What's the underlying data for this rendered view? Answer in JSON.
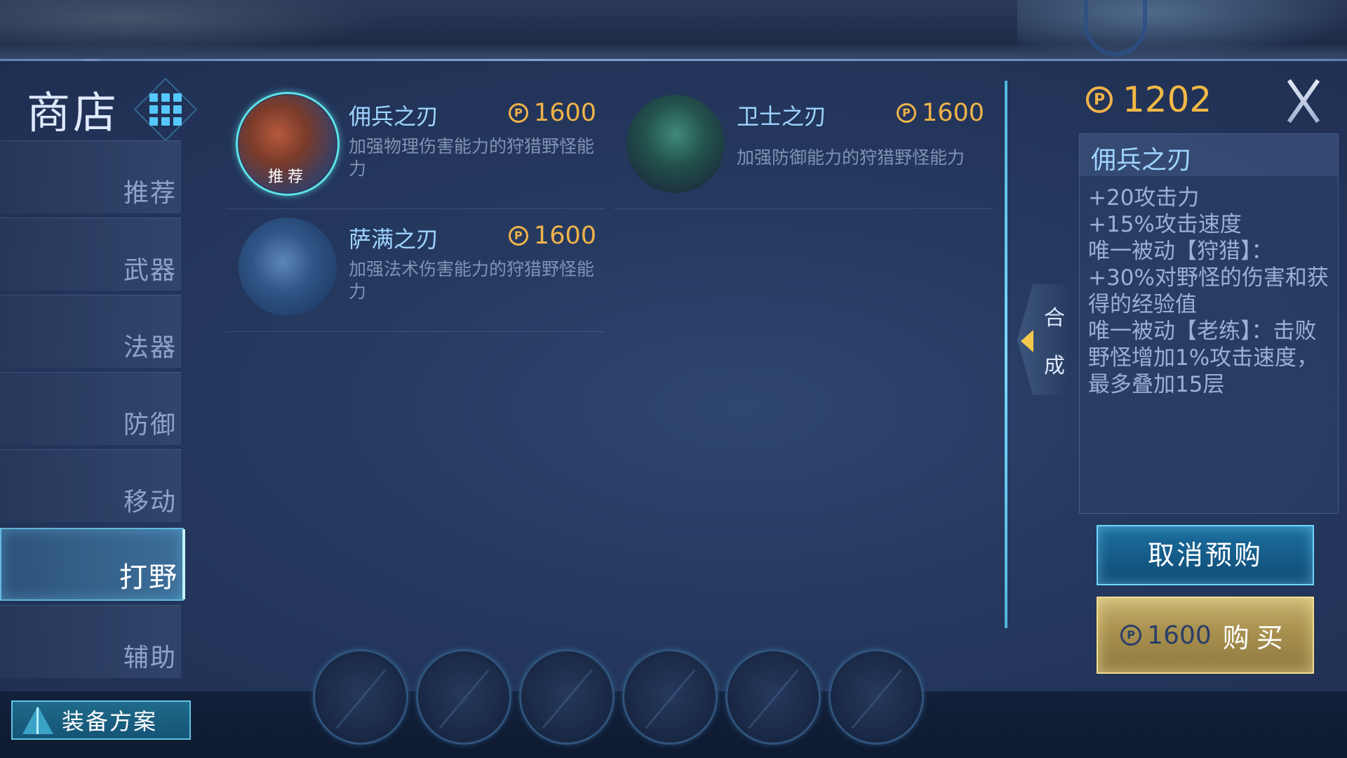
{
  "header": {
    "title": "商店",
    "gold": "1202"
  },
  "categories": [
    {
      "label": "推荐",
      "active": false
    },
    {
      "label": "武器",
      "active": false
    },
    {
      "label": "法器",
      "active": false
    },
    {
      "label": "防御",
      "active": false
    },
    {
      "label": "移动",
      "active": false
    },
    {
      "label": "打野",
      "active": true
    },
    {
      "label": "辅助",
      "active": false
    }
  ],
  "items": [
    {
      "name": "佣兵之刃",
      "price": "1600",
      "desc": "加强物理伤害能力的狩猎野怪能力",
      "badge": "推荐"
    },
    {
      "name": "卫士之刃",
      "price": "1600",
      "desc": "加强防御能力的狩猎野怪能力"
    },
    {
      "name": "萨满之刃",
      "price": "1600",
      "desc": "加强法术伤害能力的狩猎野怪能力"
    }
  ],
  "compose": {
    "line1": "合",
    "line2": "成"
  },
  "detail": {
    "name": "佣兵之刃",
    "text": "+20攻击力\n+15%攻击速度\n唯一被动【狩猎】：+30%对野怪的伤害和获得的经验值\n唯一被动【老练】：击败野怪增加1%攻击速度，最多叠加15层"
  },
  "buttons": {
    "cancel_preorder": "取消预购",
    "buy_price": "1600",
    "buy_label": "购买",
    "plan": "装备方案"
  },
  "icons": {
    "coin": "coin-icon",
    "close": "close-icon",
    "grid": "grid-icon",
    "plan": "sword-icon"
  },
  "colors": {
    "gold": "#f0b34a",
    "accent": "#5fd0ff",
    "item_name": "#9fd4ff"
  }
}
